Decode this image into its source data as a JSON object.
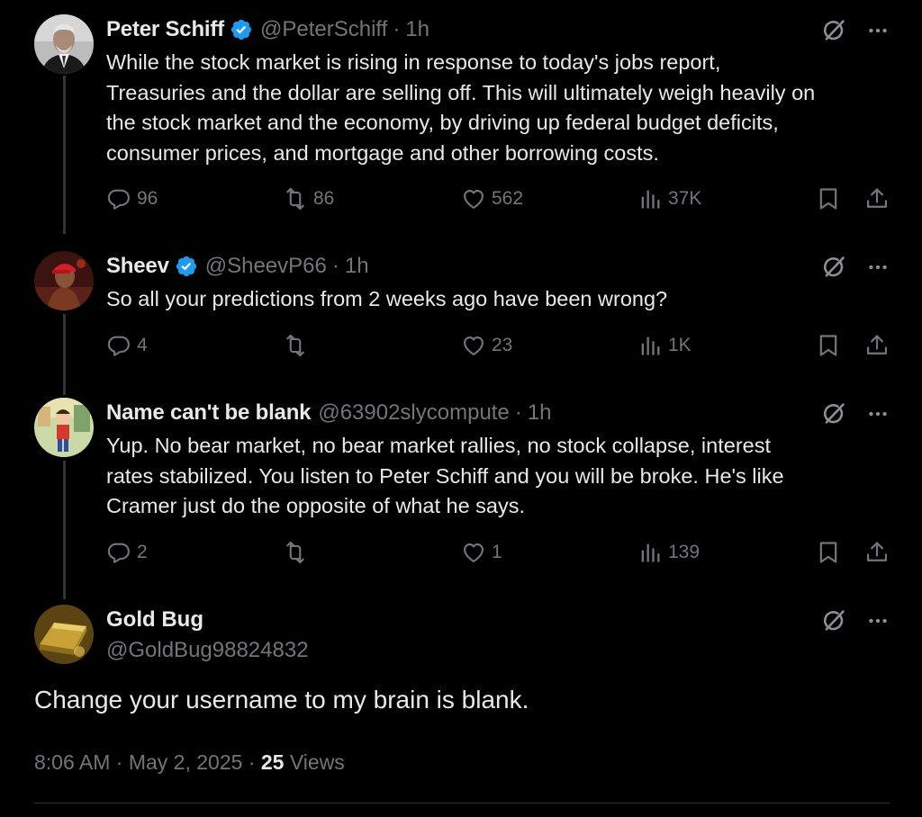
{
  "replies": [
    {
      "display_name": "Peter Schiff",
      "verified": true,
      "handle": "@PeterSchiff",
      "separator": "·",
      "time": "1h",
      "text": "While the stock market is rising in response to today's jobs report,\nTreasuries and the dollar are selling off. This will ultimately weigh heavily on\nthe stock market and the economy, by driving up federal budget deficits,\nconsumer prices, and mortgage and other borrowing costs.",
      "stats": {
        "replies": "96",
        "reposts": "86",
        "likes": "562",
        "views": "37K"
      },
      "avatar_icon": "portrait-man-suit"
    },
    {
      "display_name": "Sheev",
      "verified": true,
      "handle": "@SheevP66",
      "separator": "·",
      "time": "1h",
      "text": "So all your predictions from 2 weeks ago have been wrong?",
      "stats": {
        "replies": "4",
        "reposts": "",
        "likes": "23",
        "views": "1K"
      },
      "avatar_icon": "portrait-red-cap"
    },
    {
      "display_name": "Name can't be blank",
      "verified": false,
      "handle": "@63902slycompute",
      "separator": "·",
      "time": "1h",
      "text": "Yup. No bear market, no bear market rallies, no stock collapse, interest\nrates stabilized. You listen to Peter Schiff and you will be broke. He's like\nCramer just do the opposite of what he says.",
      "stats": {
        "replies": "2",
        "reposts": "",
        "likes": "1",
        "views": "139"
      },
      "avatar_icon": "cartoon-character"
    }
  ],
  "main_tweet": {
    "display_name": "Gold Bug",
    "handle": "@GoldBug98824832",
    "text": "Change your username to my brain is blank.",
    "time": "8:06 AM",
    "separator1": "·",
    "date": "May 2, 2025",
    "separator2": "·",
    "views_count": "25",
    "views_label": "Views",
    "avatar_icon": "gold-bars"
  },
  "colors": {
    "background": "#000000",
    "text_primary": "#e7e9ea",
    "text_secondary": "#71767b",
    "verified_blue": "#1d9bf0",
    "thread_line": "#333639"
  },
  "icons": {
    "reply": "reply-icon",
    "repost": "repost-icon",
    "like": "heart-icon",
    "views": "analytics-icon",
    "bookmark": "bookmark-icon",
    "share": "share-icon",
    "grok": "grok-icon",
    "more": "more-icon"
  }
}
